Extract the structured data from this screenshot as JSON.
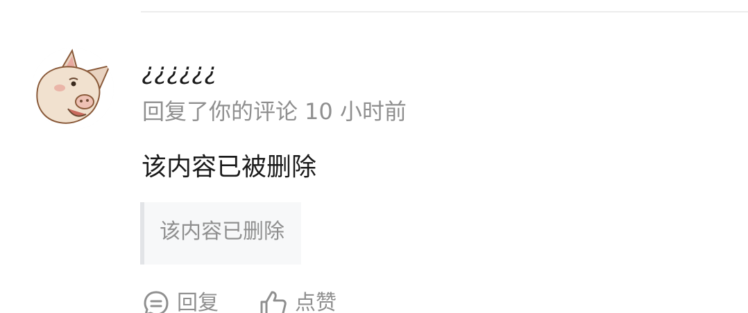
{
  "comment": {
    "username": "¿¿¿¿¿¿",
    "action_text": "回复了你的评论",
    "time": "10 小时前",
    "body": "该内容已被删除",
    "quoted": "该内容已删除"
  },
  "actions": {
    "reply_label": "回复",
    "like_label": "点赞"
  },
  "icons": {
    "avatar": "pig-avatar",
    "reply": "comment-bubble-icon",
    "like": "thumbs-up-icon"
  },
  "colors": {
    "primary_text": "#1a1a1a",
    "secondary_text": "#8f8f8f",
    "quote_bg": "#f7f8f9",
    "quote_bar": "#e2e4e7"
  }
}
